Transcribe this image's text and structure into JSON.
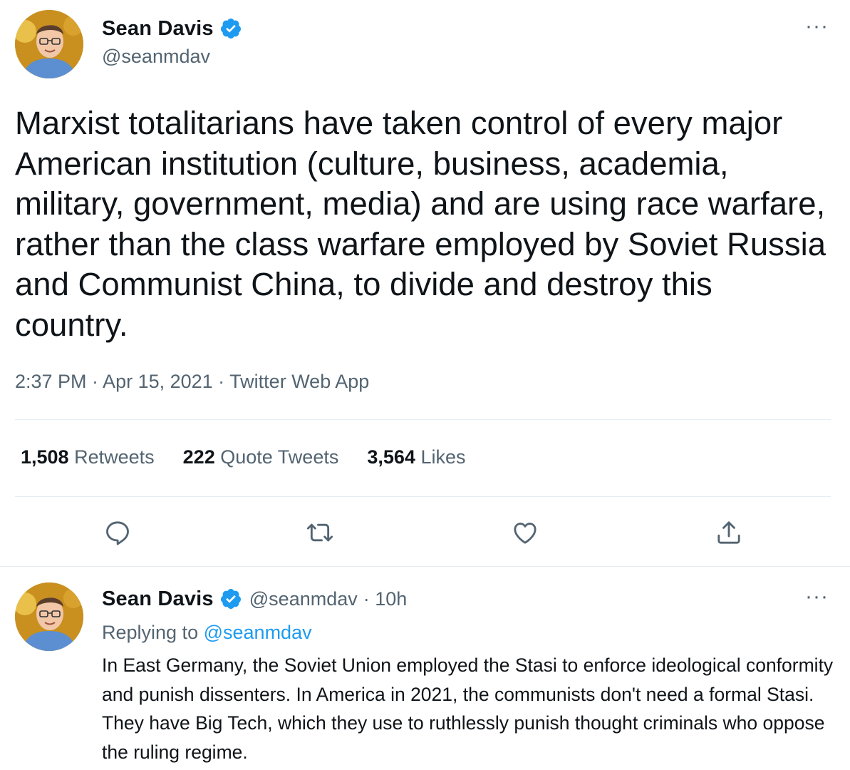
{
  "main_tweet": {
    "author_name": "Sean Davis",
    "author_handle": "@seanmdav",
    "text": "Marxist totalitarians have taken control of every major American institution (culture, business, academia, military, government, media) and are using race warfare, rather than the class warfare employed by Soviet Russia and Communist China, to divide and destroy this country.",
    "meta": "2:37 PM · Apr 15, 2021 · Twitter Web App",
    "stats": {
      "retweets_count": "1,508",
      "retweets_label": "Retweets",
      "quotes_count": "222",
      "quotes_label": "Quote Tweets",
      "likes_count": "3,564",
      "likes_label": "Likes"
    },
    "actions": [
      "reply-icon",
      "retweet-icon",
      "like-icon",
      "share-icon"
    ]
  },
  "reply_tweet": {
    "author_name": "Sean Davis",
    "author_handle": "@seanmdav",
    "time": "· 10h",
    "replying_label": "Replying to",
    "replying_handle": "@seanmdav",
    "text": "In East Germany, the Soviet Union employed the Stasi to enforce ideological conformity and punish dissenters. In America in 2021, the communists don't need a formal Stasi. They have Big Tech, which they use to ruthlessly punish thought criminals who oppose the ruling regime."
  },
  "more_glyph": "···",
  "colors": {
    "verified": "#1d9bf0",
    "secondary_text": "#536471",
    "divider": "#e6ecf0"
  }
}
